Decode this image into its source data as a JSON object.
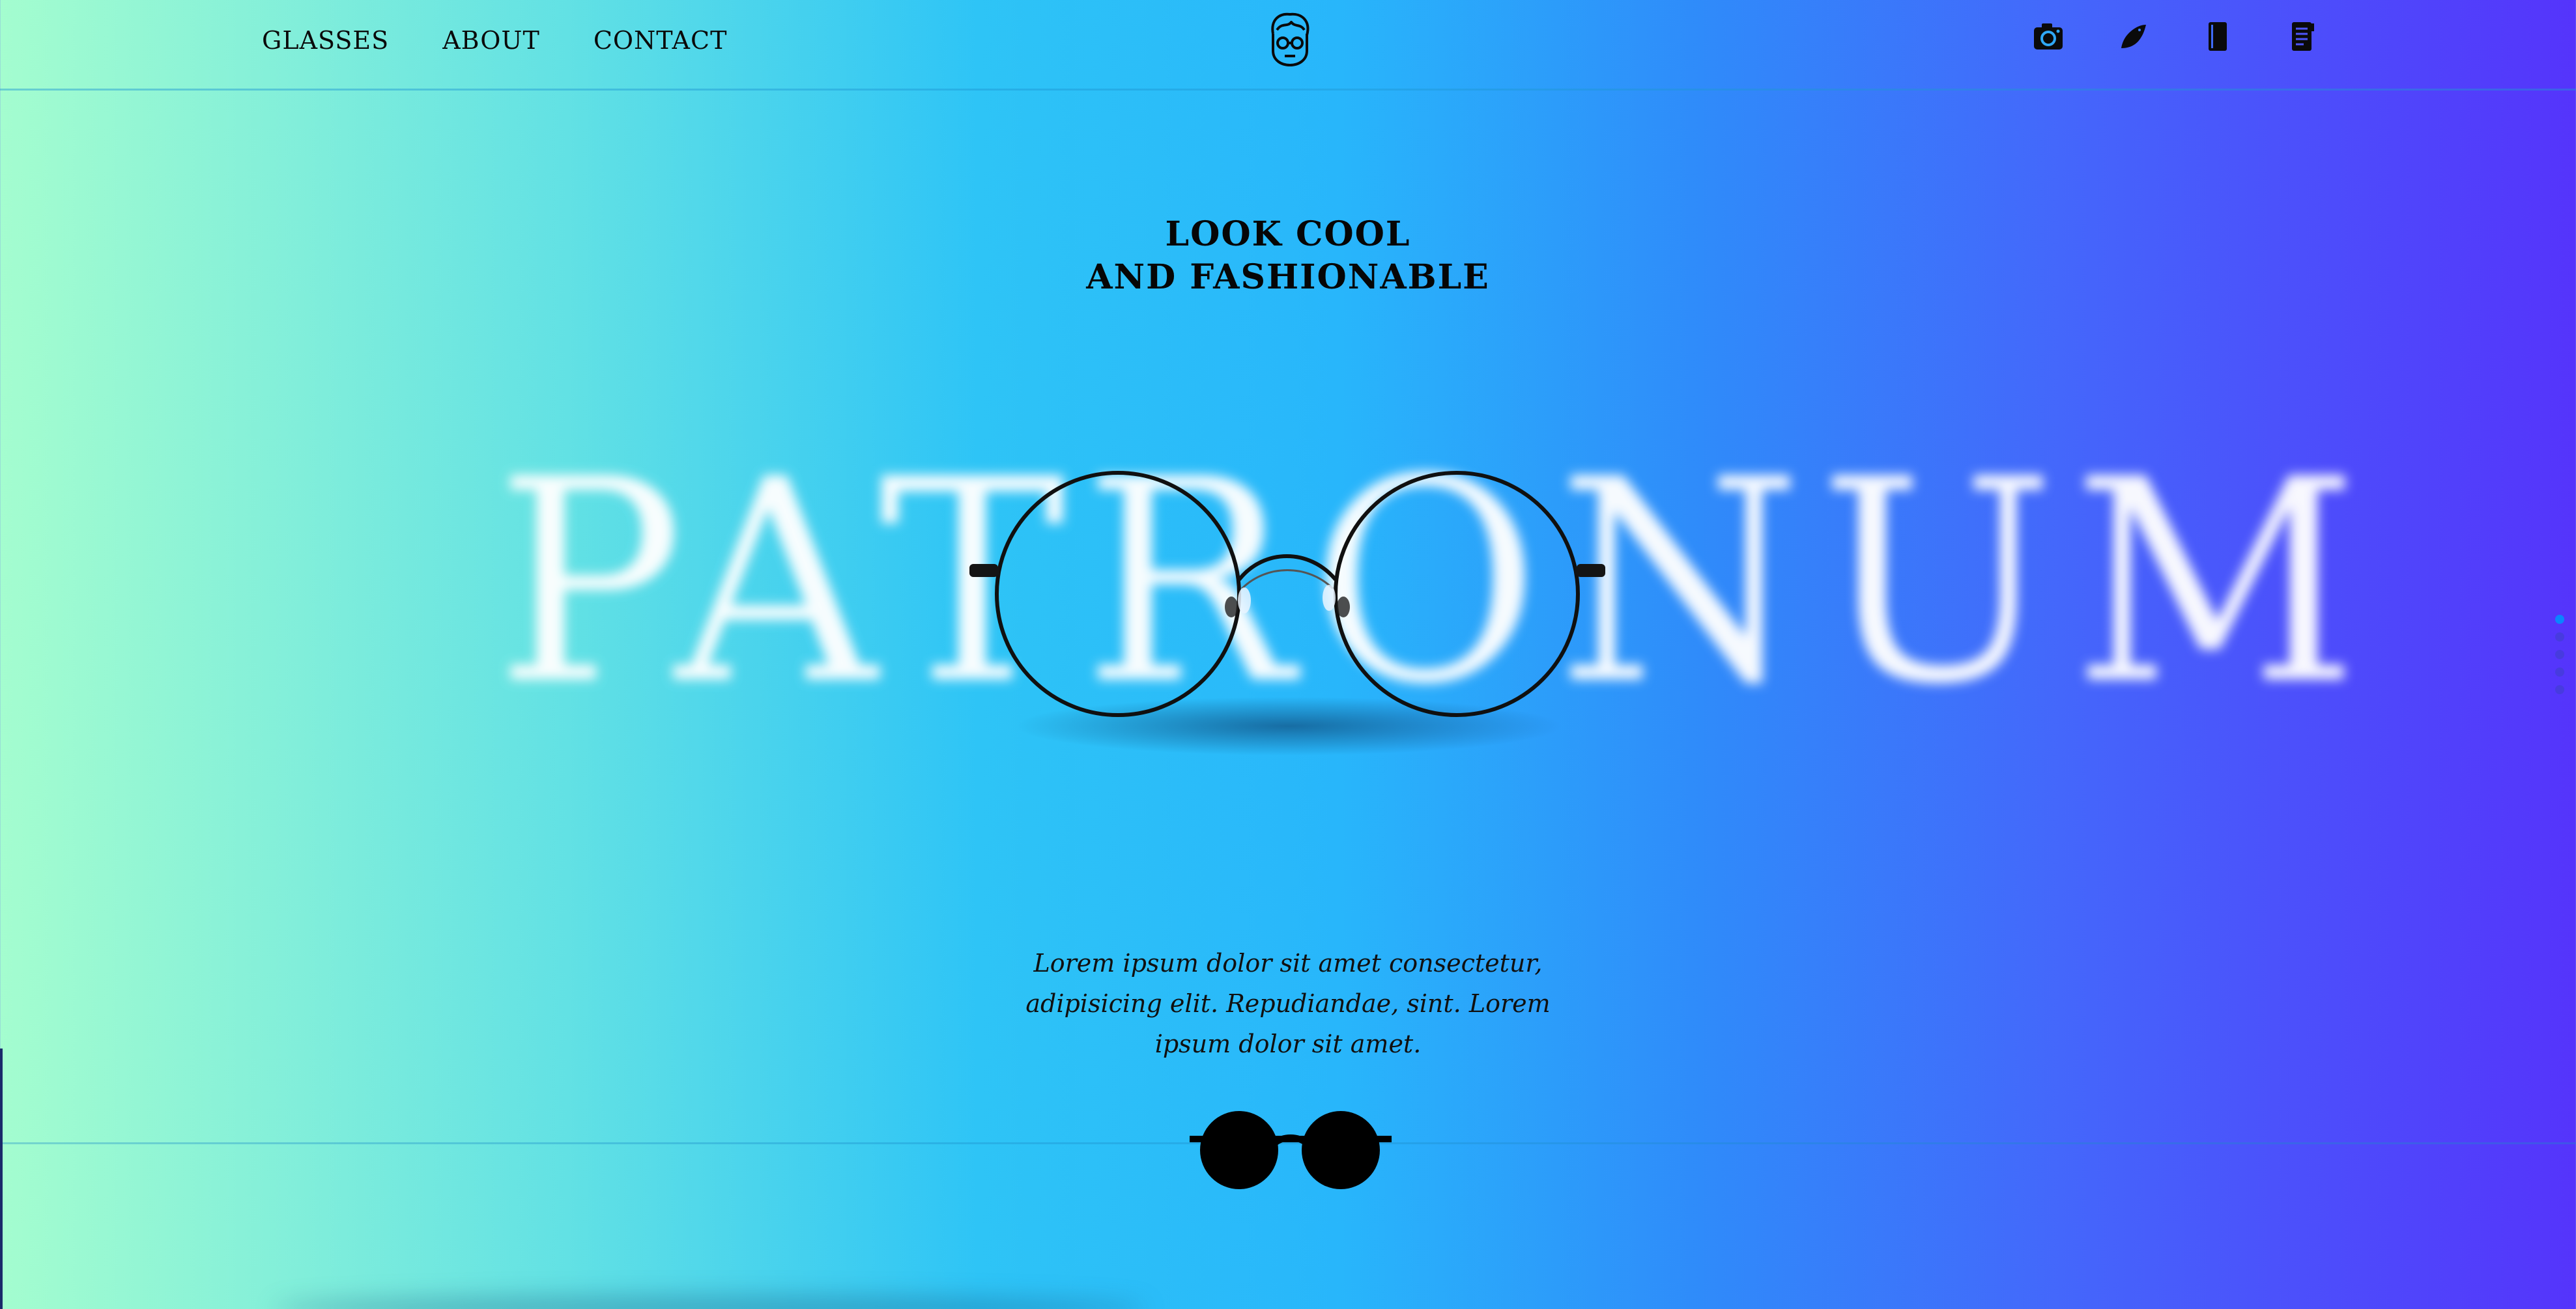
{
  "nav": {
    "items": [
      {
        "label": "GLASSES"
      },
      {
        "label": "ABOUT"
      },
      {
        "label": "CONTACT"
      }
    ]
  },
  "logo": {
    "icon": "face-with-glasses-icon"
  },
  "socials": {
    "items": [
      {
        "icon": "instagram-camera-icon"
      },
      {
        "icon": "twitter-bird-icon"
      },
      {
        "icon": "book-icon"
      },
      {
        "icon": "document-icon"
      }
    ]
  },
  "hero": {
    "tagline_line1": "LOOK COOL",
    "tagline_line2": "AND FASHIONABLE",
    "big_word": "PATRONUM",
    "description": "Lorem ipsum dolor sit amet consectetur, adipisicing elit. Repudiandae, sint. Lorem ipsum dolor sit amet."
  },
  "pagination": {
    "count": 5,
    "active_index": 0
  },
  "colors": {
    "gradient_start": "#a4fdcf",
    "gradient_middle": "#28b6fb",
    "gradient_end": "#5534fb",
    "active_dot": "#0a85ff",
    "text": "#050505"
  }
}
